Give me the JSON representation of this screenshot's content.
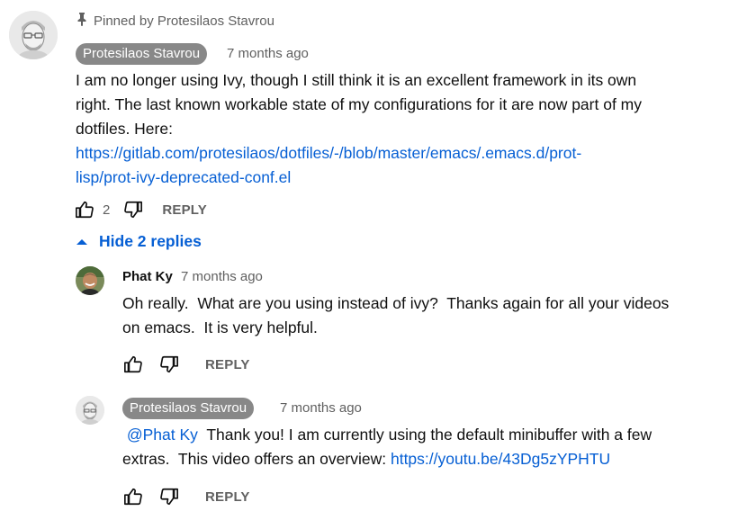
{
  "pinned": {
    "label": "Pinned by Protesilaos Stavrou"
  },
  "main_comment": {
    "author": "Protesilaos Stavrou",
    "time": "7 months ago",
    "text_lines": [
      "I am no longer using Ivy, though I still think it is an excellent framework in its own",
      "right. The last known workable state of my configurations for it are now part of my",
      "dotfiles. Here:"
    ],
    "link_lines": [
      "https://gitlab.com/protesilaos/dotfiles/-/blob/master/emacs/.emacs.d/prot-",
      "lisp/prot-ivy-deprecated-conf.el"
    ],
    "likes": "2",
    "reply_label": "REPLY"
  },
  "replies_toggle": {
    "label": "Hide 2 replies"
  },
  "replies": [
    {
      "author": "Phat Ky",
      "time": "7 months ago",
      "text_lines": [
        "Oh really.  What are you using instead of ivy?  Thanks again for all your videos",
        "on emacs.  It is very helpful."
      ],
      "reply_label": "REPLY"
    },
    {
      "author": "Protesilaos Stavrou",
      "time": "7 months ago",
      "mention": "@Phat Ky",
      "text_line1_rest": "  Thank you! I am currently using the default minibuffer with a few",
      "text_line2": "extras.  This video offers an overview: ",
      "link": "https://youtu.be/43Dg5zYPHTU",
      "reply_label": "REPLY"
    }
  ],
  "icons": {
    "pin": "pin-icon",
    "like": "thumbs-up-icon",
    "dislike": "thumbs-down-icon",
    "collapse": "caret-up-icon"
  },
  "colors": {
    "link": "#065fd4",
    "chip": "#888888",
    "muted": "#606060"
  }
}
